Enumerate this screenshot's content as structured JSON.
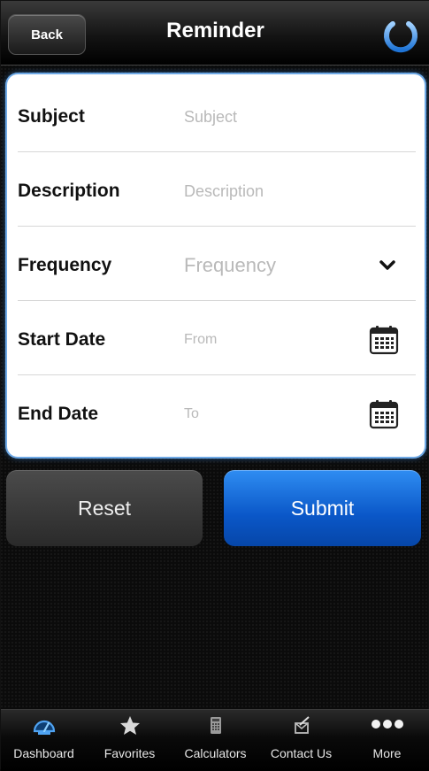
{
  "navbar": {
    "back_label": "Back",
    "title": "Reminder",
    "power_icon": "power-icon"
  },
  "form": {
    "rows": [
      {
        "label": "Subject",
        "placeholder": "Subject"
      },
      {
        "label": "Description",
        "placeholder": "Description"
      },
      {
        "label": "Frequency",
        "placeholder": "Frequency"
      },
      {
        "label": "Start Date",
        "placeholder": "From"
      },
      {
        "label": "End Date",
        "placeholder": "To"
      }
    ]
  },
  "buttons": {
    "reset_label": "Reset",
    "submit_label": "Submit"
  },
  "tabbar": {
    "items": [
      {
        "label": "Dashboard",
        "icon": "speedometer-icon"
      },
      {
        "label": "Favorites",
        "icon": "star-icon"
      },
      {
        "label": "Calculators",
        "icon": "calculator-icon"
      },
      {
        "label": "Contact Us",
        "icon": "contact-icon"
      },
      {
        "label": "More",
        "icon": "more-icon"
      }
    ]
  },
  "colors": {
    "accent": "#0a57c8",
    "card_glow": "#3c8de0",
    "active_tab_icon": "#2a7fd1"
  }
}
